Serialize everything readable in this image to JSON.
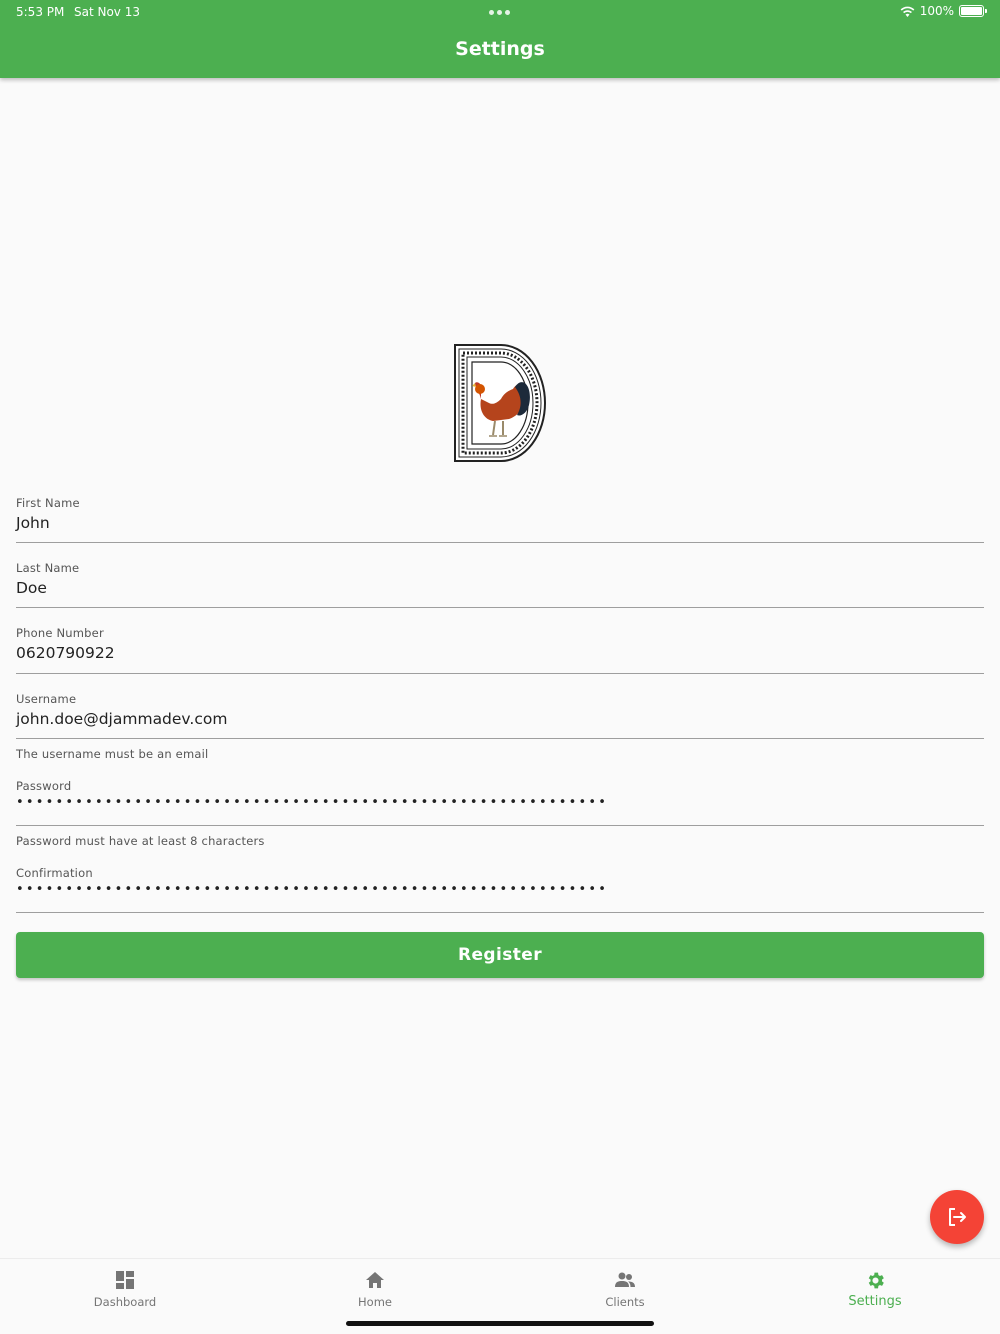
{
  "status_bar": {
    "time": "5:53 PM",
    "date": "Sat Nov 13",
    "battery": "100%"
  },
  "app_bar": {
    "title": "Settings"
  },
  "form": {
    "first_name": {
      "label": "First Name",
      "value": "John"
    },
    "last_name": {
      "label": "Last Name",
      "value": "Doe"
    },
    "phone": {
      "label": "Phone Number",
      "value": "0620790922"
    },
    "username": {
      "label": "Username",
      "value": "john.doe@djammadev.com",
      "helper": "The username must be an email"
    },
    "password": {
      "label": "Password",
      "value": "••••••••••••••••••••••••••••••••••••••••••••••••••••••••••••",
      "helper": "Password must have at least 8 characters"
    },
    "confirmation": {
      "label": "Confirmation",
      "value": "••••••••••••••••••••••••••••••••••••••••••••••••••••••••••••"
    },
    "register_label": "Register"
  },
  "fab": {
    "icon": "logout-icon",
    "color": "#f44336"
  },
  "bottom_nav": {
    "items": [
      {
        "label": "Dashboard",
        "icon": "dashboard-icon",
        "active": false
      },
      {
        "label": "Home",
        "icon": "home-icon",
        "active": false
      },
      {
        "label": "Clients",
        "icon": "people-icon",
        "active": false
      },
      {
        "label": "Settings",
        "icon": "gear-icon",
        "active": true
      }
    ]
  },
  "colors": {
    "primary": "#4caf50",
    "danger": "#f44336",
    "inactive": "#757575"
  }
}
